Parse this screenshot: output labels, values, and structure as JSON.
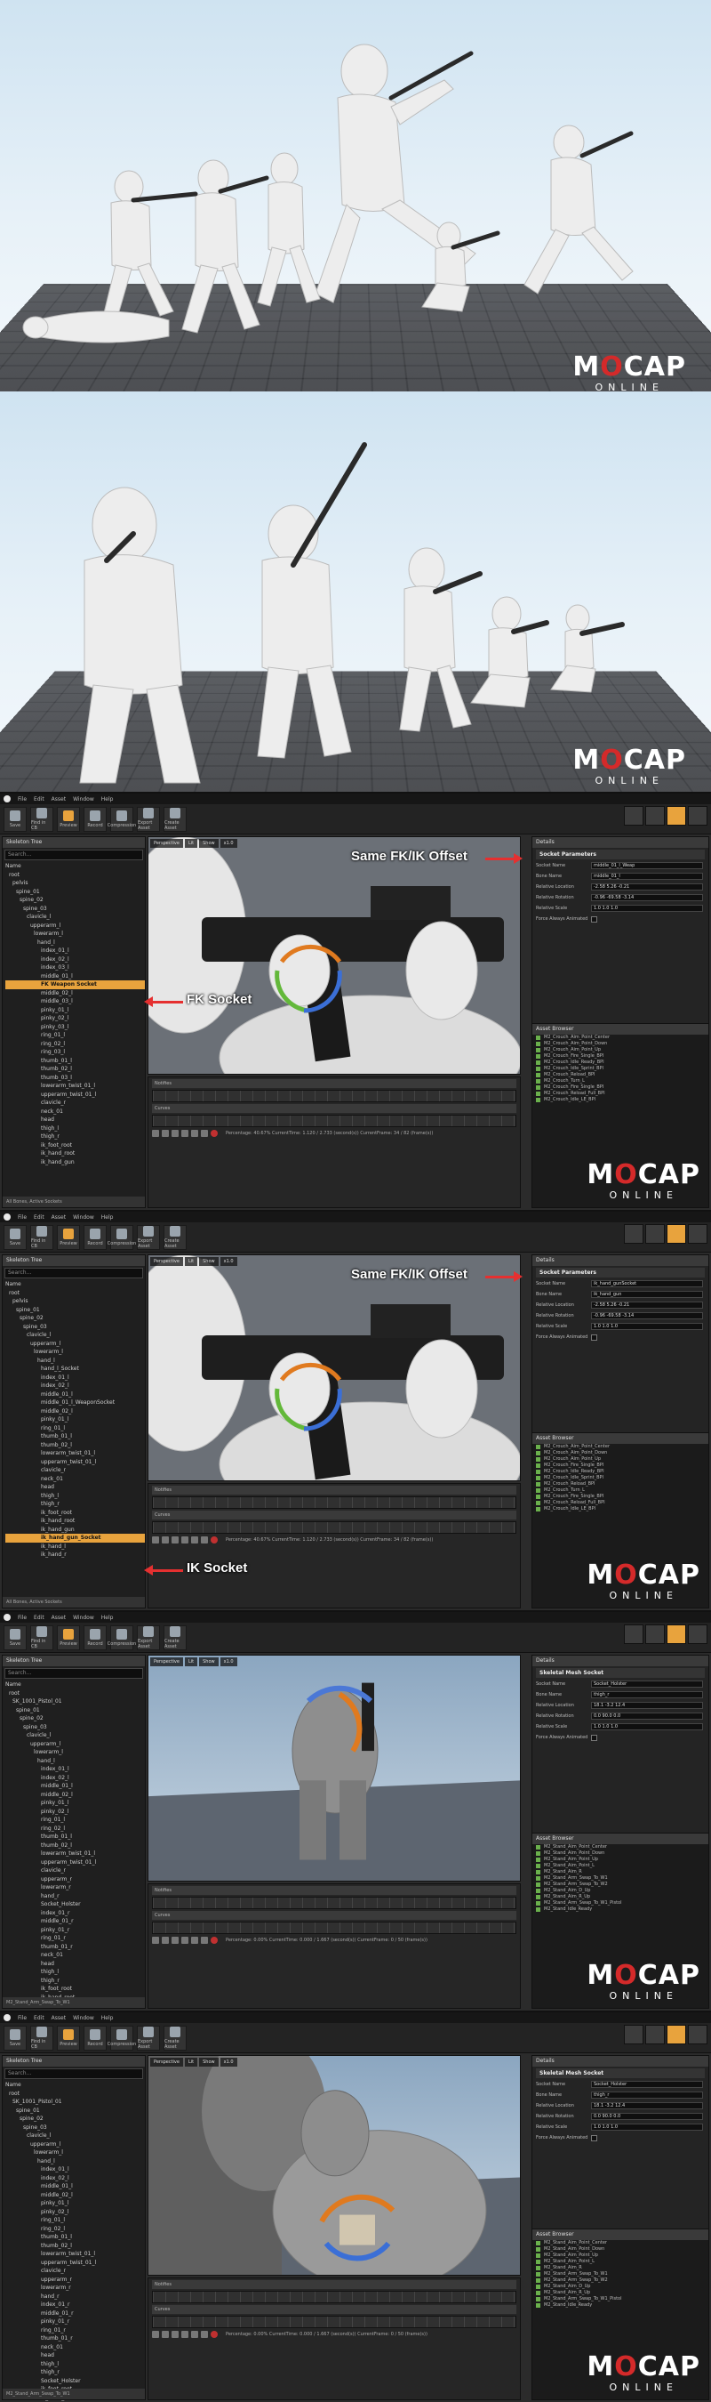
{
  "logo": {
    "brand": "MOCAP",
    "sub": "ONLINE"
  },
  "editor": {
    "menu": [
      "File",
      "Edit",
      "Asset",
      "Window",
      "Help"
    ],
    "toolbar": [
      "Save",
      "Find in CB",
      "Preview",
      "Record",
      "Compression",
      "Export Asset",
      "Create Asset"
    ]
  },
  "screen1": {
    "tree": [
      "Name",
      "root",
      "pelvis",
      "spine_01",
      "spine_02",
      "spine_03",
      "clavicle_l",
      "upperarm_l",
      "lowerarm_l",
      "hand_l",
      "index_01_l",
      "index_02_l",
      "index_03_l",
      "middle_01_l",
      "FK Weapon Socket",
      "middle_02_l",
      "middle_03_l",
      "pinky_01_l",
      "pinky_02_l",
      "pinky_03_l",
      "ring_01_l",
      "ring_02_l",
      "ring_03_l",
      "thumb_01_l",
      "thumb_02_l",
      "thumb_03_l",
      "lowerarm_twist_01_l",
      "upperarm_twist_01_l",
      "clavicle_r",
      "neck_01",
      "head",
      "thigh_l",
      "thigh_r",
      "ik_foot_root",
      "ik_hand_root",
      "ik_hand_gun"
    ],
    "highlight_row": 14,
    "footer": "All Bones, Active Sockets",
    "callout_offset": "Same FK/IK Offset",
    "callout_socket": "FK Socket",
    "details_title": "Socket Parameters",
    "props": [
      {
        "label": "Socket Name",
        "value": "middle_01_l_Weap"
      },
      {
        "label": "Bone Name",
        "value": "middle_01_l"
      },
      {
        "label": "Relative Location",
        "value": "-2.58   5.26   -0.21"
      },
      {
        "label": "Relative Rotation",
        "value": "-0.96   -69.58   -3.14"
      },
      {
        "label": "Relative Scale",
        "value": "1.0   1.0   1.0"
      },
      {
        "label": "Force Always Animated",
        "value": ""
      }
    ],
    "assets_title": "Asset Browser",
    "assets": [
      "M2_Crouch_Aim_Point_Center",
      "M2_Crouch_Aim_Point_Down",
      "M2_Crouch_Aim_Point_Up",
      "M2_Crouch_Fire_Single_BPI",
      "M2_Crouch_Idle_Ready_BPI",
      "M2_Crouch_Idle_Sprint_BPI",
      "M2_Crouch_Reload_BPI",
      "M2_Crouch_Turn_L",
      "M2_Crouch_Fire_Single_BPI",
      "M2_Crouch_Reload_Full_BPI",
      "M2_Crouch_Idle_LE_BPI"
    ],
    "timeline": "Notifies",
    "timeline2": "Curves",
    "playback": "Percentage: 40.67%  CurrentTime: 1.120 / 2.733 (second(s))  CurrentFrame: 34 / 82 (frame(s))"
  },
  "screen2": {
    "tree": [
      "Name",
      "root",
      "pelvis",
      "spine_01",
      "spine_02",
      "spine_03",
      "clavicle_l",
      "upperarm_l",
      "lowerarm_l",
      "hand_l",
      "hand_l_Socket",
      "index_01_l",
      "index_02_l",
      "middle_01_l",
      "middle_01_l_WeaponSocket",
      "middle_02_l",
      "pinky_01_l",
      "ring_01_l",
      "thumb_01_l",
      "thumb_02_l",
      "lowerarm_twist_01_l",
      "upperarm_twist_01_l",
      "clavicle_r",
      "neck_01",
      "head",
      "thigh_l",
      "thigh_r",
      "ik_foot_root",
      "ik_hand_root",
      "ik_hand_gun",
      "ik_hand_gun_Socket",
      "ik_hand_l",
      "ik_hand_r"
    ],
    "highlight_row": 30,
    "footer": "All Bones, Active Sockets",
    "callout_offset": "Same FK/IK Offset",
    "callout_socket": "IK Socket",
    "details_title": "Socket Parameters",
    "props": [
      {
        "label": "Socket Name",
        "value": "ik_hand_gunSocket"
      },
      {
        "label": "Bone Name",
        "value": "ik_hand_gun"
      },
      {
        "label": "Relative Location",
        "value": "-2.58   5.26   -0.21"
      },
      {
        "label": "Relative Rotation",
        "value": "-0.96   -69.58   -3.14"
      },
      {
        "label": "Relative Scale",
        "value": "1.0   1.0   1.0"
      },
      {
        "label": "Force Always Animated",
        "value": ""
      }
    ],
    "assets_title": "Asset Browser",
    "assets": [
      "M2_Crouch_Aim_Point_Center",
      "M2_Crouch_Aim_Point_Down",
      "M2_Crouch_Aim_Point_Up",
      "M2_Crouch_Fire_Single_BPI",
      "M2_Crouch_Idle_Ready_BPI",
      "M2_Crouch_Idle_Sprint_BPI",
      "M2_Crouch_Reload_BPI",
      "M2_Crouch_Turn_L",
      "M2_Crouch_Fire_Single_BPI",
      "M2_Crouch_Reload_Full_BPI",
      "M2_Crouch_Idle_LE_BPI"
    ],
    "timeline": "Notifies",
    "timeline2": "Curves",
    "playback": "Percentage: 40.67%  CurrentTime: 1.120 / 2.733 (second(s))  CurrentFrame: 34 / 82 (frame(s))"
  },
  "screen3": {
    "tree": [
      "Name",
      "root",
      "SK_1001_Pistol_01",
      "spine_01",
      "spine_02",
      "spine_03",
      "clavicle_l",
      "upperarm_l",
      "lowerarm_l",
      "hand_l",
      "index_01_l",
      "index_02_l",
      "middle_01_l",
      "middle_02_l",
      "pinky_01_l",
      "pinky_02_l",
      "ring_01_l",
      "ring_02_l",
      "thumb_01_l",
      "thumb_02_l",
      "lowerarm_twist_01_l",
      "upperarm_twist_01_l",
      "clavicle_r",
      "upperarm_r",
      "lowerarm_r",
      "hand_r",
      "Socket_Holster",
      "index_01_r",
      "middle_01_r",
      "pinky_01_r",
      "ring_01_r",
      "thumb_01_r",
      "neck_01",
      "head",
      "thigh_l",
      "thigh_r",
      "ik_foot_root",
      "ik_hand_root"
    ],
    "highlight_row": -1,
    "footer": "M2_Stand_Arm_Swap_To_W1",
    "details_title": "Skeletal Mesh Socket",
    "props": [
      {
        "label": "Socket Name",
        "value": "Socket_Holster"
      },
      {
        "label": "Bone Name",
        "value": "thigh_r"
      },
      {
        "label": "Relative Location",
        "value": "18.1   -3.2   12.4"
      },
      {
        "label": "Relative Rotation",
        "value": "0.0   90.0   0.0"
      },
      {
        "label": "Relative Scale",
        "value": "1.0   1.0   1.0"
      },
      {
        "label": "Force Always Animated",
        "value": ""
      }
    ],
    "assets_title": "Asset Browser",
    "assets": [
      "M2_Stand_Aim_Point_Center",
      "M2_Stand_Aim_Point_Down",
      "M2_Stand_Aim_Point_Up",
      "M2_Stand_Aim_Point_L",
      "M2_Stand_Aim_R",
      "M2_Stand_Arm_Swap_To_W1",
      "M2_Stand_Arm_Swap_To_W2",
      "M2_Stand_Aim_D_Up",
      "M2_Stand_Aim_R_Up",
      "M2_Stand_Arm_Swap_To_W1_Pistol",
      "M2_Stand_Idle_Ready"
    ],
    "clip": "M2_Stand_Arm_Swap_To_W1",
    "timeline": "Notifies",
    "timeline2": "Curves",
    "playback": "Percentage: 0.00%  CurrentTime: 0.000 / 1.667 (second(s))  CurrentFrame: 0 / 50 (frame(s))"
  },
  "screen4": {
    "tree": [
      "Name",
      "root",
      "SK_1001_Pistol_01",
      "spine_01",
      "spine_02",
      "spine_03",
      "clavicle_l",
      "upperarm_l",
      "lowerarm_l",
      "hand_l",
      "index_01_l",
      "index_02_l",
      "middle_01_l",
      "middle_02_l",
      "pinky_01_l",
      "pinky_02_l",
      "ring_01_l",
      "ring_02_l",
      "thumb_01_l",
      "thumb_02_l",
      "lowerarm_twist_01_l",
      "upperarm_twist_01_l",
      "clavicle_r",
      "upperarm_r",
      "lowerarm_r",
      "hand_r",
      "index_01_r",
      "middle_01_r",
      "pinky_01_r",
      "ring_01_r",
      "thumb_01_r",
      "neck_01",
      "head",
      "thigh_l",
      "thigh_r",
      "Socket_Holster",
      "ik_foot_root",
      "ik_hand_root"
    ],
    "highlight_row": -1,
    "footer": "M2_Stand_Arm_Swap_To_W1",
    "details_title": "Skeletal Mesh Socket",
    "props": [
      {
        "label": "Socket Name",
        "value": "Socket_Holster"
      },
      {
        "label": "Bone Name",
        "value": "thigh_r"
      },
      {
        "label": "Relative Location",
        "value": "18.1   -3.2   12.4"
      },
      {
        "label": "Relative Rotation",
        "value": "0.0   90.0   0.0"
      },
      {
        "label": "Relative Scale",
        "value": "1.0   1.0   1.0"
      },
      {
        "label": "Force Always Animated",
        "value": ""
      }
    ],
    "assets_title": "Asset Browser",
    "assets": [
      "M2_Stand_Aim_Point_Center",
      "M2_Stand_Aim_Point_Down",
      "M2_Stand_Aim_Point_Up",
      "M2_Stand_Aim_Point_L",
      "M2_Stand_Aim_R",
      "M2_Stand_Arm_Swap_To_W1",
      "M2_Stand_Arm_Swap_To_W2",
      "M2_Stand_Aim_D_Up",
      "M2_Stand_Aim_R_Up",
      "M2_Stand_Arm_Swap_To_W1_Pistol",
      "M2_Stand_Idle_Ready"
    ],
    "clip": "M2_Stand_Arm_Swap_To_W1",
    "timeline": "Notifies",
    "timeline2": "Curves",
    "playback": "Percentage: 0.00%  CurrentTime: 0.000 / 1.667 (second(s))  CurrentFrame: 0 / 50 (frame(s))"
  }
}
